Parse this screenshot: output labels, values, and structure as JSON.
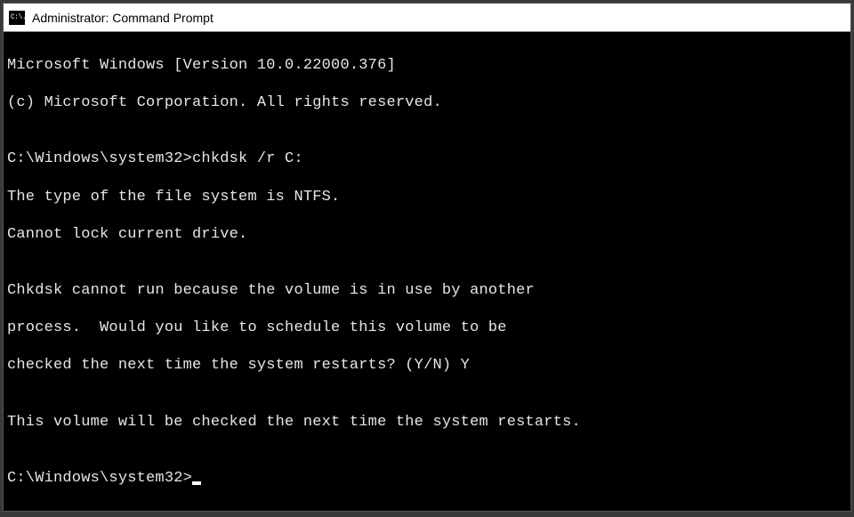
{
  "titlebar": {
    "icon_glyph": "C:\\.",
    "title": "Administrator: Command Prompt"
  },
  "terminal": {
    "lines": {
      "l0": "Microsoft Windows [Version 10.0.22000.376]",
      "l1": "(c) Microsoft Corporation. All rights reserved.",
      "l2": "",
      "l3": "C:\\Windows\\system32>chkdsk /r C:",
      "l4": "The type of the file system is NTFS.",
      "l5": "Cannot lock current drive.",
      "l6": "",
      "l7": "Chkdsk cannot run because the volume is in use by another",
      "l8": "process.  Would you like to schedule this volume to be",
      "l9": "checked the next time the system restarts? (Y/N) Y",
      "l10": "",
      "l11": "This volume will be checked the next time the system restarts.",
      "l12": "",
      "prompt": "C:\\Windows\\system32>"
    }
  }
}
